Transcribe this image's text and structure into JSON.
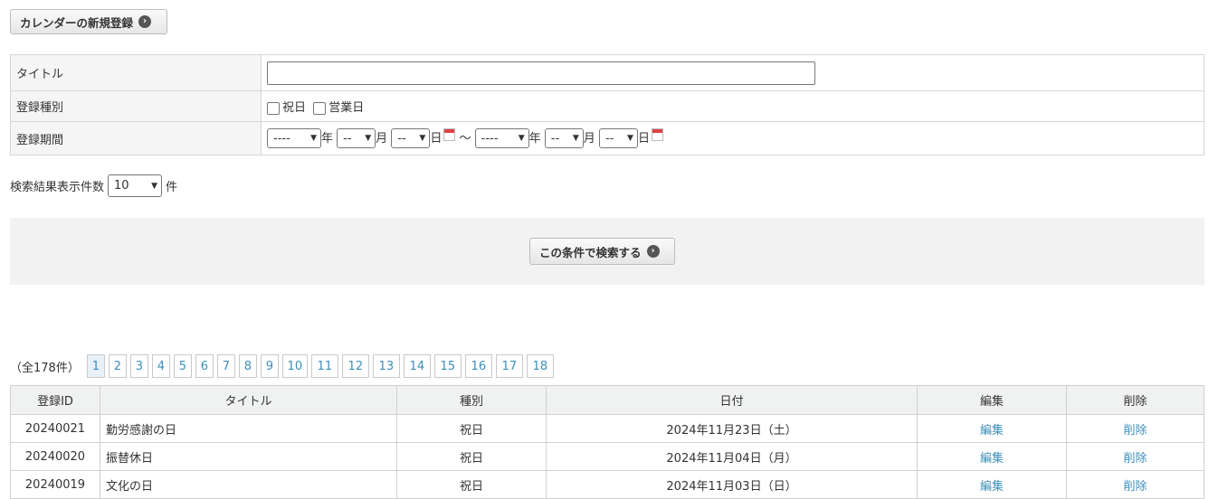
{
  "new_button": "カレンダーの新規登録",
  "form": {
    "title_label": "タイトル",
    "type_label": "登録種別",
    "type_options": [
      "祝日",
      "営業日"
    ],
    "period_label": "登録期間",
    "year_placeholder": "----",
    "md_placeholder": "--",
    "year_unit": "年",
    "month_unit": "月",
    "day_unit": "日",
    "tilde": "～"
  },
  "per_page": {
    "label": "検索結果表示件数",
    "value": "10",
    "unit": "件"
  },
  "search_button": "この条件で検索する",
  "pager": {
    "total": "（全178件）",
    "pages": [
      "1",
      "2",
      "3",
      "4",
      "5",
      "6",
      "7",
      "8",
      "9",
      "10",
      "11",
      "12",
      "13",
      "14",
      "15",
      "16",
      "17",
      "18"
    ],
    "current": "1"
  },
  "table": {
    "headers": [
      "登録ID",
      "タイトル",
      "種別",
      "日付",
      "編集",
      "削除"
    ],
    "rows": [
      {
        "id": "20240021",
        "title": "勤労感謝の日",
        "type": "祝日",
        "date": "2024年11月23日（土）",
        "edit": "編集",
        "delete": "削除"
      },
      {
        "id": "20240020",
        "title": "振替休日",
        "type": "祝日",
        "date": "2024年11月04日（月）",
        "edit": "編集",
        "delete": "削除"
      },
      {
        "id": "20240019",
        "title": "文化の日",
        "type": "祝日",
        "date": "2024年11月03日（日）",
        "edit": "編集",
        "delete": "削除"
      }
    ]
  }
}
